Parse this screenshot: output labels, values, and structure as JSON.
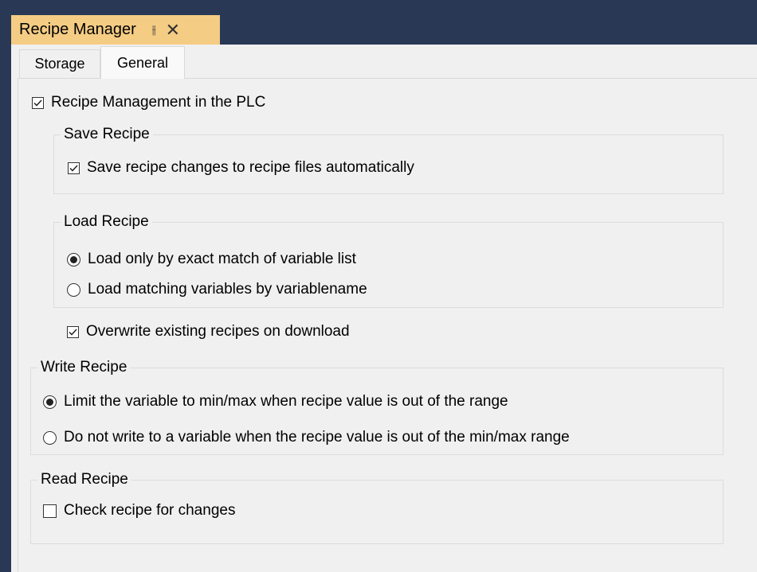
{
  "window": {
    "title": "Recipe Manager",
    "pin_icon": "pin-icon",
    "close_icon": "close-icon"
  },
  "tabs": [
    {
      "label": "Storage",
      "active": false
    },
    {
      "label": "General",
      "active": true
    }
  ],
  "general": {
    "recipe_management": {
      "label": "Recipe Management in the PLC",
      "checked": true
    },
    "save_recipe": {
      "legend": "Save Recipe",
      "auto_save": {
        "label": "Save recipe changes to recipe files automatically",
        "checked": true
      }
    },
    "load_recipe": {
      "legend": "Load Recipe",
      "options": [
        {
          "label": "Load only by exact match of variable list",
          "selected": true
        },
        {
          "label": "Load matching variables by variablename",
          "selected": false
        }
      ]
    },
    "overwrite": {
      "label": "Overwrite existing recipes on download",
      "checked": true
    },
    "write_recipe": {
      "legend": "Write Recipe",
      "options": [
        {
          "label": "Limit the variable to min/max when recipe value is out of the range",
          "selected": true
        },
        {
          "label": "Do not write to a variable when the recipe value is out of the min/max range",
          "selected": false
        }
      ]
    },
    "read_recipe": {
      "legend": "Read Recipe",
      "check_changes": {
        "label": "Check recipe for changes",
        "checked": false
      }
    }
  },
  "colors": {
    "title_bar": "#293955",
    "active_doc_tab": "#f5cc84",
    "panel": "#f0f0f0"
  }
}
